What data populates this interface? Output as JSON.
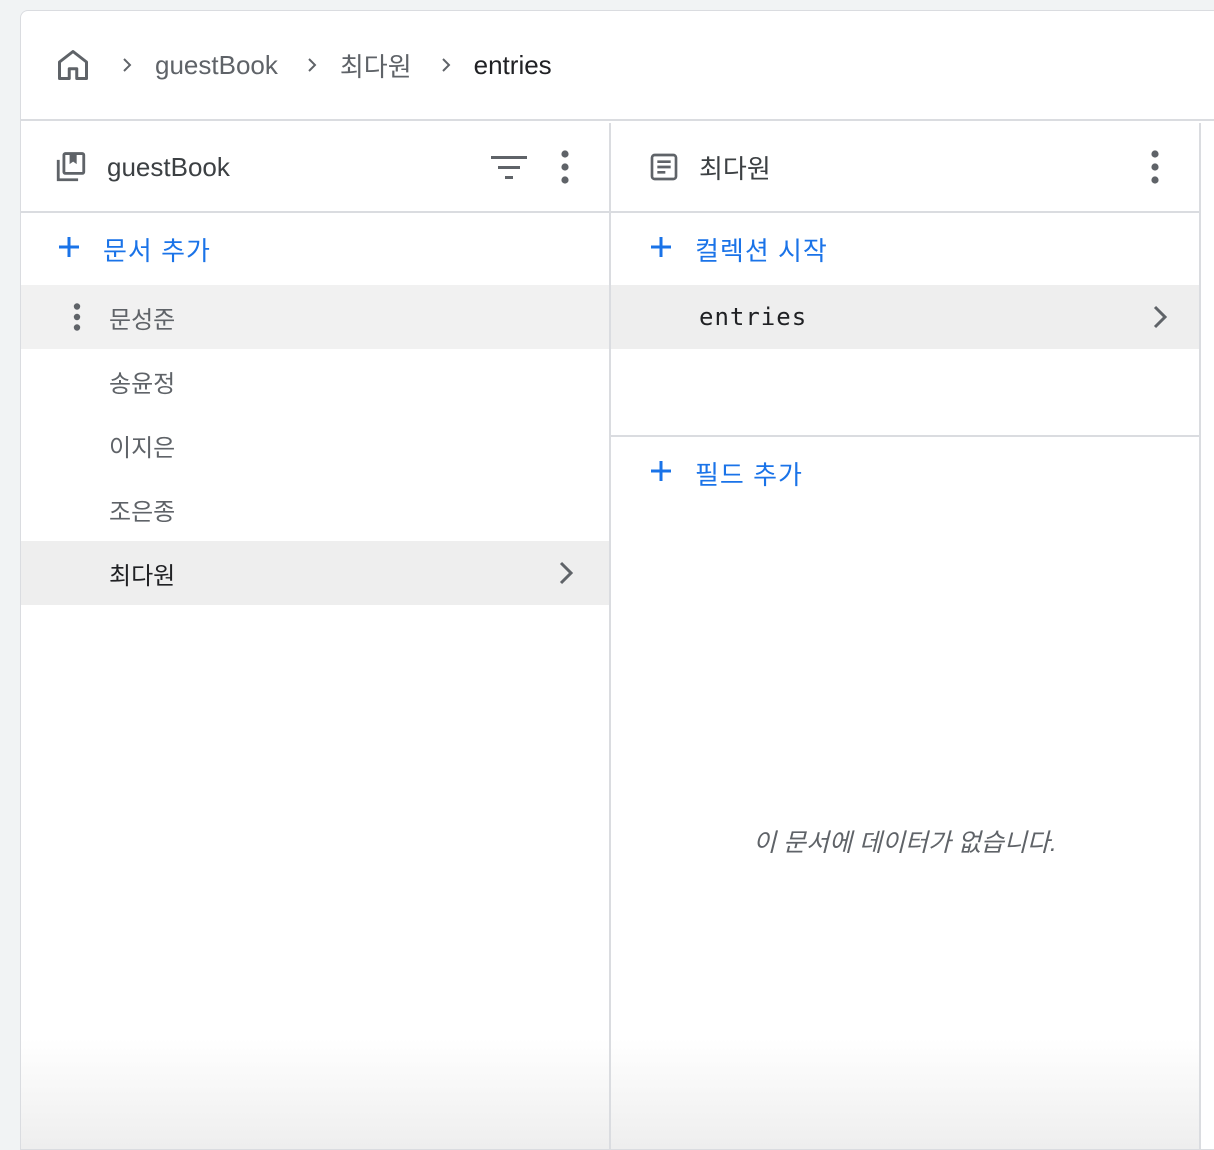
{
  "breadcrumb": {
    "home_icon": "home-icon",
    "items": [
      "guestBook",
      "최다원",
      "entries"
    ]
  },
  "left_panel": {
    "title": "guestBook",
    "icon": "collection-icon",
    "add_label": "문서 추가",
    "documents": [
      "문성준",
      "송윤정",
      "이지은",
      "조은종",
      "최다원"
    ],
    "selected_document": "최다원",
    "hovered_document": "문성준"
  },
  "mid_panel": {
    "title": "최다원",
    "icon": "document-icon",
    "start_collection_label": "컬렉션 시작",
    "collections": [
      "entries"
    ],
    "add_field_label": "필드 추가",
    "empty_message": "이 문서에 데이터가 없습니다."
  },
  "colors": {
    "accent": "#1a73e8",
    "border": "#dadce0",
    "selected_bg": "#eeeeee",
    "text_muted": "#5f6368"
  }
}
